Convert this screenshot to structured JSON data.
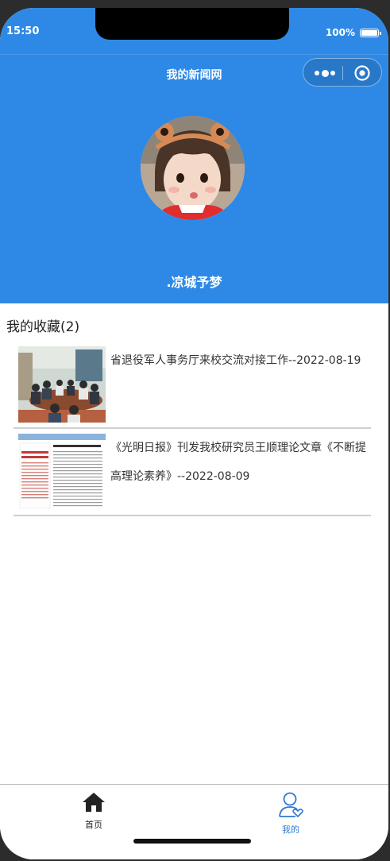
{
  "status": {
    "time": "15:50",
    "battery": "100%"
  },
  "navbar": {
    "title": "我的新闻网"
  },
  "profile": {
    "username": ".凉城予梦"
  },
  "favorites": {
    "heading": "我的收藏(2)",
    "items": [
      {
        "title": "省退役军人事务厅来校交流对接工作--2022-08-19"
      },
      {
        "title": "《光明日报》刊发我校研究员王顺理论文章《不断提高理论素养》--2022-08-09"
      }
    ]
  },
  "tabbar": {
    "tabs": [
      {
        "label": "首页",
        "icon": "home-icon",
        "color": "#222222"
      },
      {
        "label": "我的",
        "icon": "user-heart-icon",
        "color": "#2e7ad1"
      }
    ]
  },
  "colors": {
    "primary": "#2e89e6",
    "tab_active": "#2e7ad1"
  }
}
